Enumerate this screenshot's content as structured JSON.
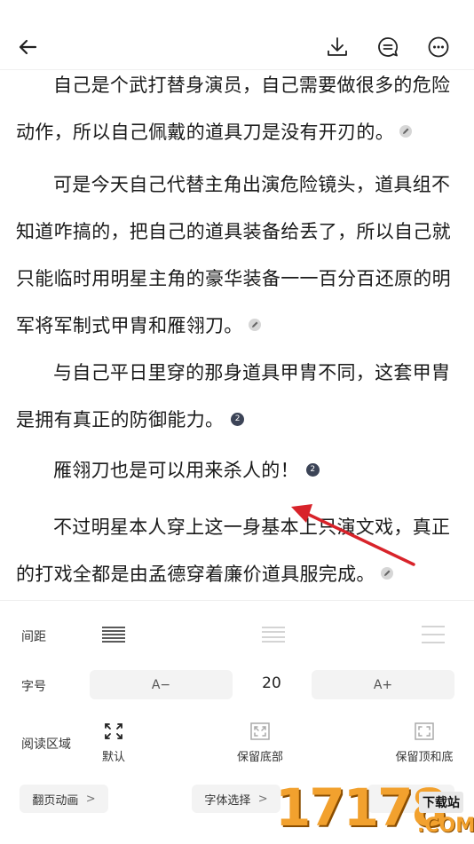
{
  "paragraphs": [
    {
      "line1": "自己是个武打替身演员，自己需要做很多的危",
      "rest": "险动作，所以自己佩戴的道具刀是没有开刃的。",
      "marker": "note"
    },
    {
      "line1": "可是今天自己代替主角出演危险镜头，道具组",
      "rest": "不知道咋搞的，把自己的道具装备给丢了，所以自己就只能临时用明星主角的豪华装备一一百分百还原的明军将军制式甲胄和雁翎刀。",
      "marker": "note"
    },
    {
      "line1": "与自己平日里穿的那身道具甲胄不同，这套甲",
      "rest": "胄是拥有真正的防御能力。",
      "marker": "badge",
      "badge": "2"
    },
    {
      "line1": "雁翎刀也是可以用来杀人的！",
      "rest": "",
      "marker": "badge",
      "badge": "2"
    },
    {
      "line1": "不过明星本人穿上这一身基本上只演文戏，真",
      "rest": "正的打戏全都是由孟德穿着廉价道具服完成。",
      "marker": "note"
    }
  ],
  "settings": {
    "spacing_label": "间距",
    "font_size_label": "字号",
    "font_decrease": "A−",
    "font_size_value": "20",
    "font_increase": "A+",
    "reading_area_label": "阅读区域",
    "reading_options": [
      "默认",
      "保留底部",
      "保留顶和底"
    ],
    "page_anim": "翻页动画",
    "font_select": "字体选择",
    "chevron": ">"
  },
  "watermark": {
    "text": "17178",
    "tag": "下载站",
    "sub": ".COM"
  },
  "colors": {
    "arrow": "#d8232a",
    "badge": "#3c4457",
    "panel_btn": "#f3f3f3"
  }
}
